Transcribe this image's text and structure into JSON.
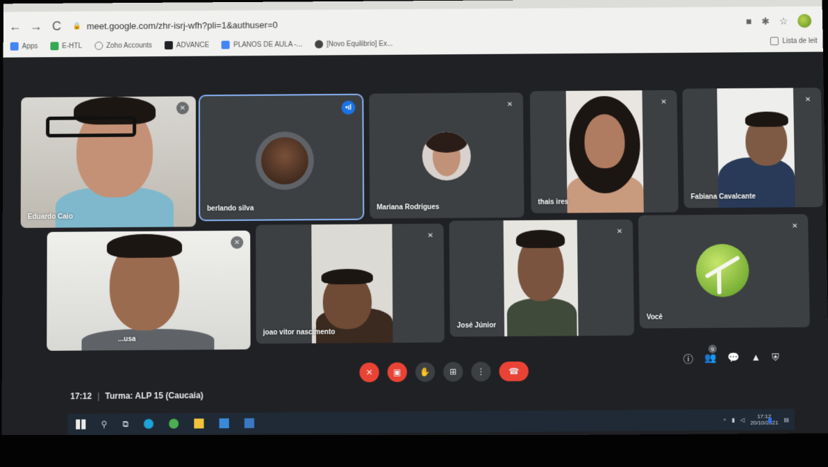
{
  "browser": {
    "url": "meet.google.com/zhr-isrj-wfh?pli=1&authuser=0",
    "bookmarks": [
      "Apps",
      "E-HTL",
      "Zoho Accounts",
      "ADVANCE",
      "PLANOS DE AULA -...",
      "[Novo Equilibrio] Ex..."
    ],
    "reading_list": "Lista de leit"
  },
  "participants": [
    {
      "name": "Eduardo Caio",
      "muted": true
    },
    {
      "name": "berlando silva",
      "speaking": true
    },
    {
      "name": "Mariana Rodrigues",
      "muted": true
    },
    {
      "name": "thais ires",
      "muted": true
    },
    {
      "name": "Fabiana Cavalcante",
      "muted": true
    },
    {
      "name": "...usa",
      "muted": true
    },
    {
      "name": "joao vitor nascimento",
      "muted": true
    },
    {
      "name": "José Júnior",
      "muted": true
    },
    {
      "name": "Você",
      "muted": true
    }
  ],
  "meeting": {
    "time": "17:12",
    "title": "Turma: ALP 15 (Caucaia)",
    "people_count": "9"
  },
  "taskbar": {
    "clock_time": "17:12",
    "clock_date": "20/10/2021"
  },
  "colors": {
    "meet_bg": "#202124",
    "tile_bg": "#3c4043",
    "active_outline": "#8ab4f8",
    "danger": "#ea4335"
  }
}
